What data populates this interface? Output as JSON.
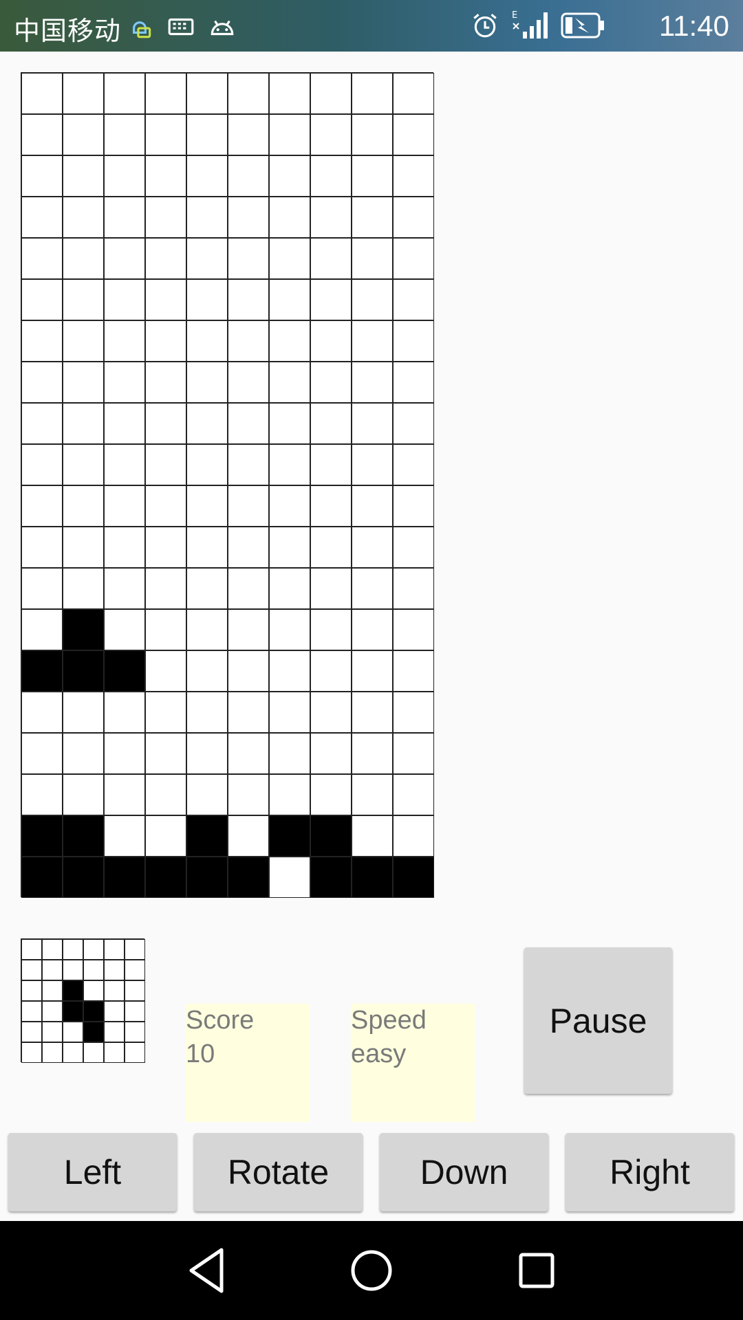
{
  "status_bar": {
    "carrier": "中国移动",
    "network_type": "E",
    "time": "11:40",
    "icons": [
      "notification-app-icon",
      "keyboard-icon",
      "android-icon",
      "alarm-icon",
      "signal-icon",
      "battery-charging-icon"
    ]
  },
  "board": {
    "columns": 10,
    "rows": 20,
    "filled_cells": [
      [
        13,
        1
      ],
      [
        14,
        0
      ],
      [
        14,
        1
      ],
      [
        14,
        2
      ],
      [
        18,
        0
      ],
      [
        18,
        1
      ],
      [
        18,
        4
      ],
      [
        18,
        6
      ],
      [
        18,
        7
      ],
      [
        19,
        0
      ],
      [
        19,
        1
      ],
      [
        19,
        2
      ],
      [
        19,
        3
      ],
      [
        19,
        4
      ],
      [
        19,
        5
      ],
      [
        19,
        7
      ],
      [
        19,
        8
      ],
      [
        19,
        9
      ]
    ]
  },
  "next_piece": {
    "columns": 6,
    "rows": 6,
    "filled_cells": [
      [
        2,
        2
      ],
      [
        3,
        2
      ],
      [
        3,
        3
      ],
      [
        4,
        3
      ]
    ]
  },
  "score": {
    "label": "Score",
    "value": "10"
  },
  "speed": {
    "label": "Speed",
    "value": "easy"
  },
  "buttons": {
    "pause": "Pause",
    "left": "Left",
    "rotate": "Rotate",
    "down": "Down",
    "right": "Right"
  },
  "nav": [
    "back-icon",
    "home-icon",
    "recents-icon"
  ]
}
